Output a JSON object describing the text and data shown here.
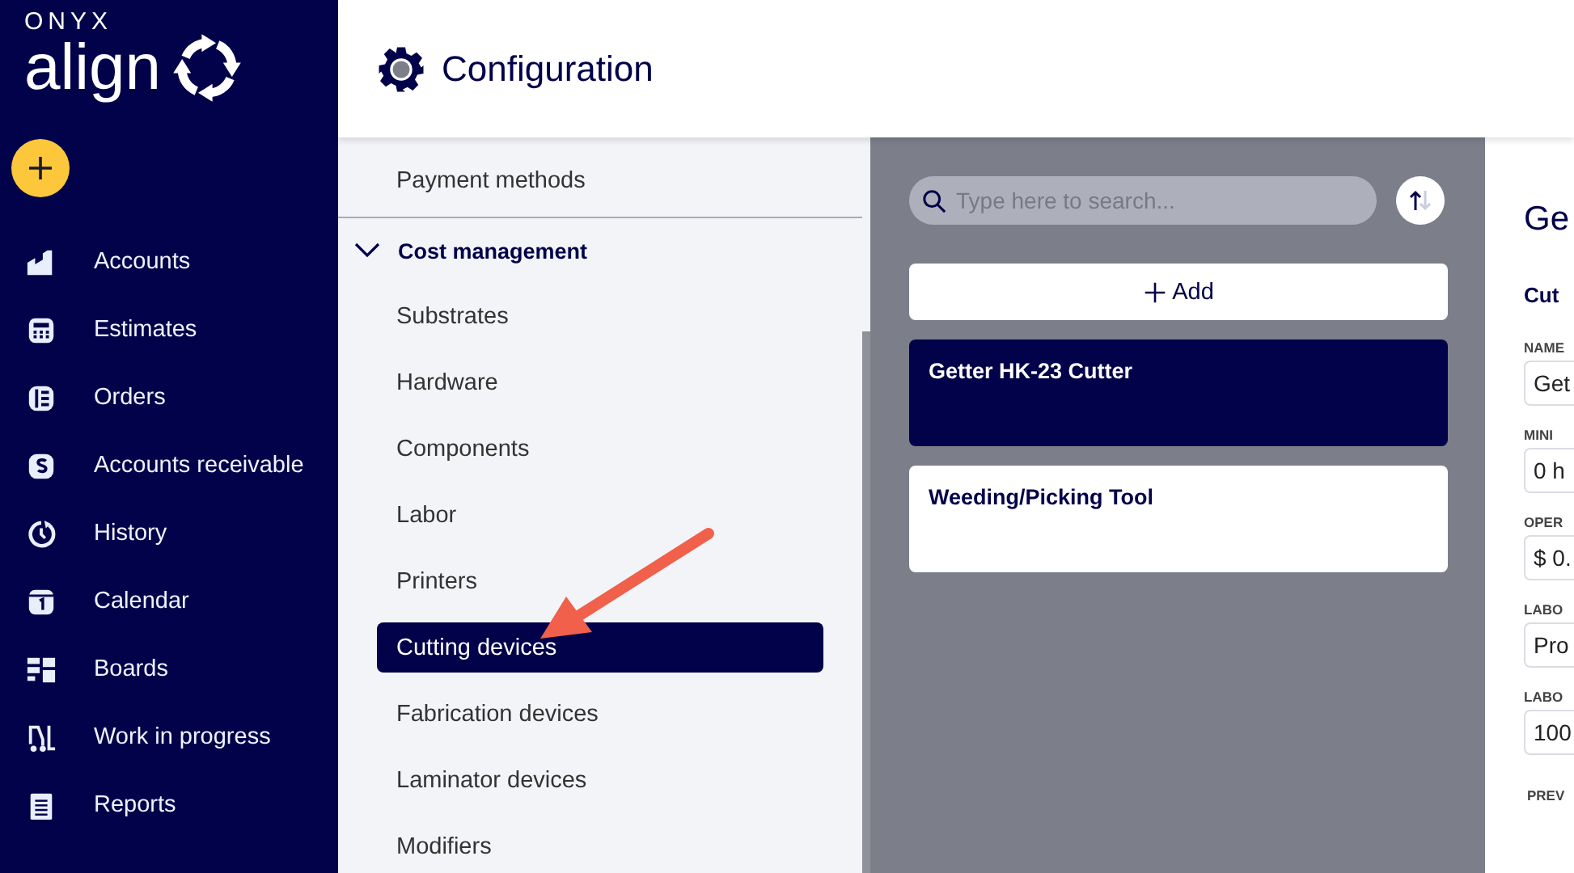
{
  "logo": {
    "brand": "ONYX",
    "product": "align"
  },
  "nav": [
    {
      "label": "Accounts"
    },
    {
      "label": "Estimates"
    },
    {
      "label": "Orders"
    },
    {
      "label": "Accounts receivable"
    },
    {
      "label": "History"
    },
    {
      "label": "Calendar"
    },
    {
      "label": "Boards"
    },
    {
      "label": "Work in progress"
    },
    {
      "label": "Reports"
    }
  ],
  "header": {
    "title": "Configuration"
  },
  "config_menu": [
    {
      "label": "Payment methods",
      "kind": "item",
      "selected": false
    },
    {
      "label": "Cost management",
      "kind": "group",
      "expanded": true,
      "children": [
        {
          "label": "Substrates",
          "selected": false
        },
        {
          "label": "Hardware",
          "selected": false
        },
        {
          "label": "Components",
          "selected": false
        },
        {
          "label": "Labor",
          "selected": false
        },
        {
          "label": "Printers",
          "selected": false
        },
        {
          "label": "Cutting devices",
          "selected": true
        },
        {
          "label": "Fabrication devices",
          "selected": false
        },
        {
          "label": "Laminator devices",
          "selected": false
        },
        {
          "label": "Modifiers",
          "selected": false
        }
      ]
    }
  ],
  "search": {
    "placeholder": "Type here to search..."
  },
  "add_button": "Add",
  "devices": [
    {
      "name": "Getter HK-23 Cutter",
      "selected": true
    },
    {
      "name": "Weeding/Picking Tool",
      "selected": false
    }
  ],
  "detail": {
    "title": "Ge",
    "section": "Cut",
    "fields": [
      {
        "label": "NAME",
        "value": "Get"
      },
      {
        "label": "MINI",
        "value": "0 h"
      },
      {
        "label": "OPER",
        "value": "$ 0."
      },
      {
        "label": "LABO",
        "value": "Pro"
      },
      {
        "label": "LABO",
        "value": "100"
      }
    ],
    "footer_label": "PREV"
  },
  "annotations": [
    {
      "kind": "arrow"
    }
  ]
}
